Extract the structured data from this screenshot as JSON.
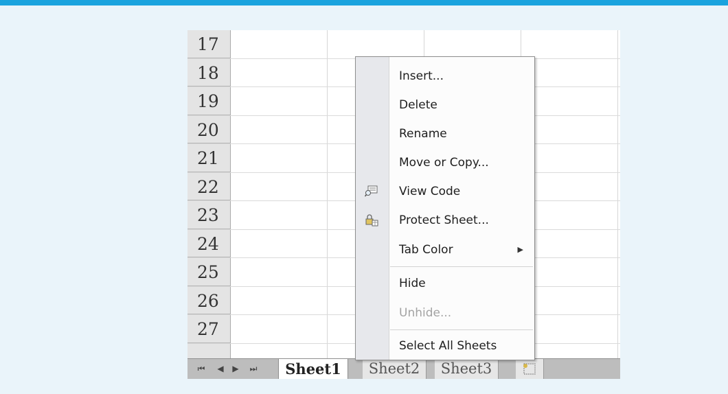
{
  "rows": [
    "17",
    "18",
    "19",
    "20",
    "21",
    "22",
    "23",
    "24",
    "25",
    "26",
    "27"
  ],
  "sheet_tabs": {
    "nav_buttons": [
      "first-sheet",
      "previous-sheet",
      "next-sheet",
      "last-sheet"
    ],
    "nav_glyphs": [
      "⏮",
      "◀",
      "▶",
      "⏭"
    ],
    "tabs": [
      "Sheet1",
      "Sheet2",
      "Sheet3"
    ],
    "active_tab": "Sheet1"
  },
  "context_menu": {
    "items": [
      {
        "label": "Insert...",
        "icon": null
      },
      {
        "label": "Delete",
        "icon": null
      },
      {
        "label": "Rename",
        "icon": null
      },
      {
        "label": "Move or Copy...",
        "icon": null
      },
      {
        "label": "View Code",
        "icon": "view-code-icon"
      },
      {
        "label": "Protect Sheet...",
        "icon": "protect-sheet-icon"
      },
      {
        "label": "Tab Color",
        "icon": null,
        "submenu": true
      },
      {
        "label": "Hide",
        "icon": null
      },
      {
        "label": "Unhide...",
        "icon": null,
        "disabled": true
      },
      {
        "label": "Select All Sheets",
        "icon": null
      }
    ]
  },
  "colors": {
    "accent_bar": "#1aa3de",
    "background": "#eaf4fa"
  }
}
